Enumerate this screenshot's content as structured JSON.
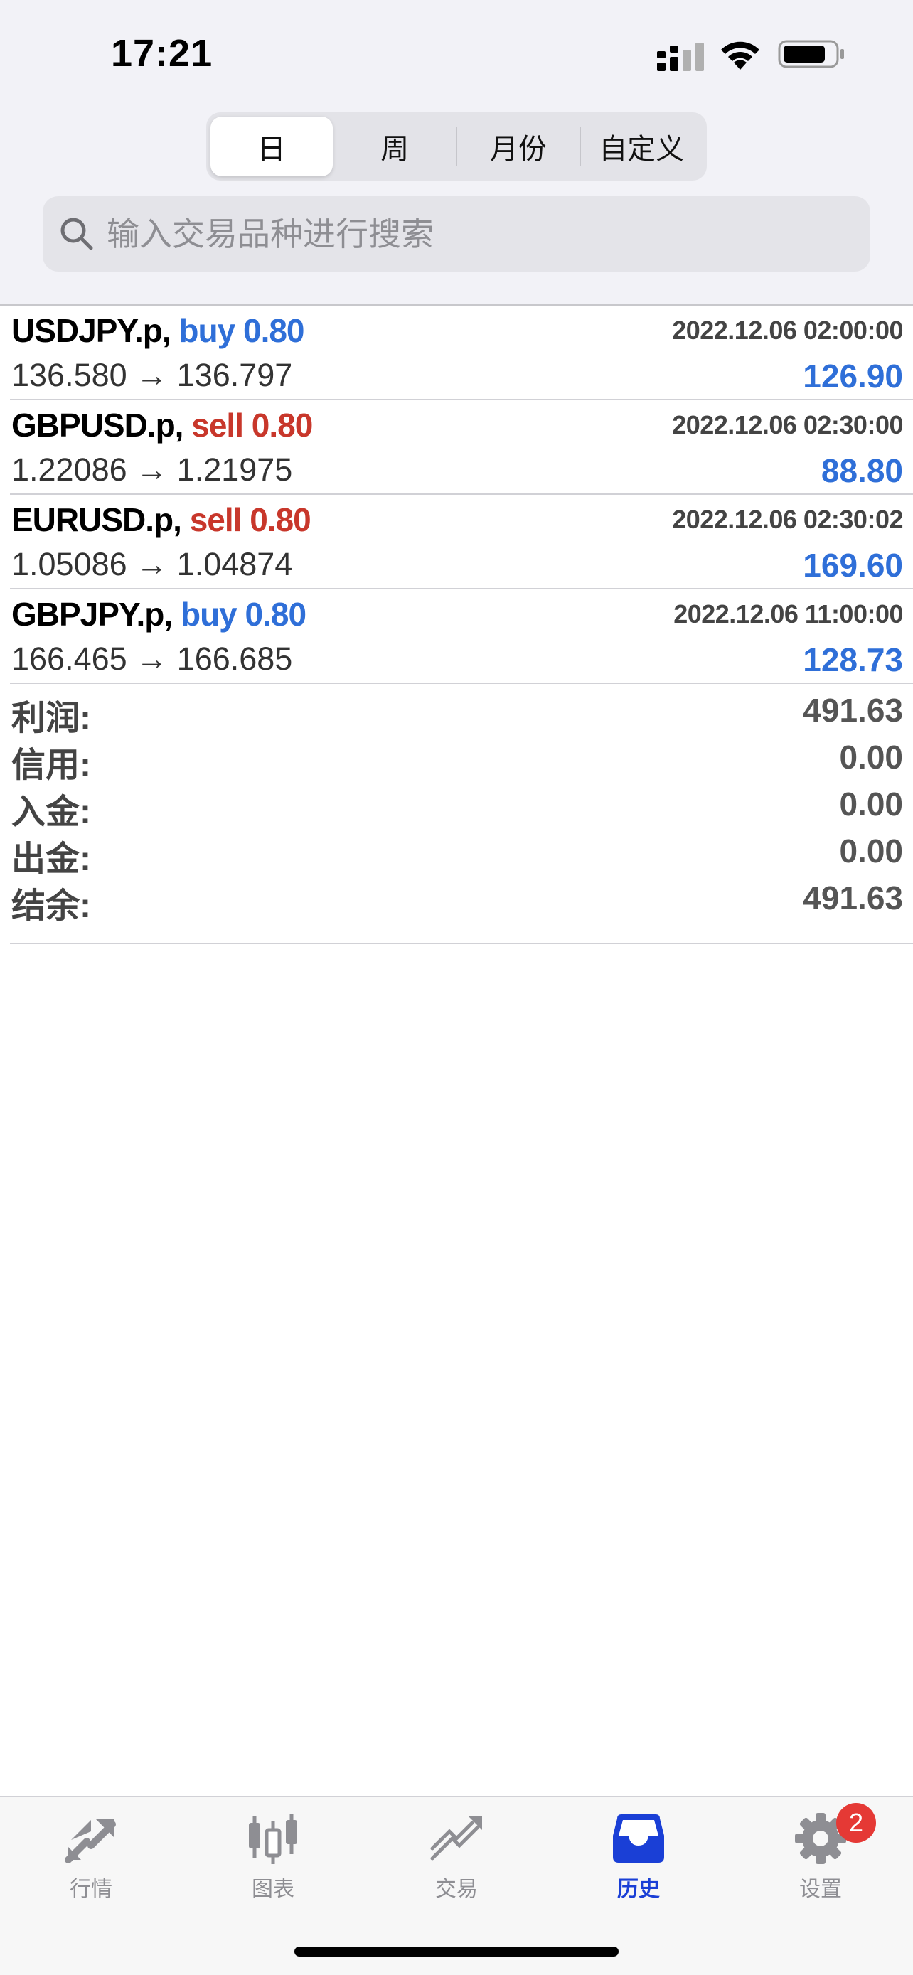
{
  "status_bar": {
    "time": "17:21"
  },
  "period_tabs": [
    {
      "label": "日",
      "active": true
    },
    {
      "label": "周",
      "active": false
    },
    {
      "label": "月份",
      "active": false
    },
    {
      "label": "自定义",
      "active": false
    }
  ],
  "search": {
    "placeholder": "输入交易品种进行搜索"
  },
  "trades": [
    {
      "symbol": "USDJPY.p,",
      "side": "buy",
      "volume": "0.80",
      "time": "2022.12.06 02:00:00",
      "prices": "136.580 → 136.797",
      "profit": "126.90"
    },
    {
      "symbol": "GBPUSD.p,",
      "side": "sell",
      "volume": "0.80",
      "time": "2022.12.06 02:30:00",
      "prices": "1.22086 → 1.21975",
      "profit": "88.80"
    },
    {
      "symbol": "EURUSD.p,",
      "side": "sell",
      "volume": "0.80",
      "time": "2022.12.06 02:30:02",
      "prices": "1.05086 → 1.04874",
      "profit": "169.60"
    },
    {
      "symbol": "GBPJPY.p,",
      "side": "buy",
      "volume": "0.80",
      "time": "2022.12.06 11:00:00",
      "prices": "166.465 → 166.685",
      "profit": "128.73"
    }
  ],
  "summary": [
    {
      "label": "利润:",
      "value": "491.63"
    },
    {
      "label": "信用:",
      "value": "0.00"
    },
    {
      "label": "入金:",
      "value": "0.00"
    },
    {
      "label": "出金:",
      "value": "0.00"
    },
    {
      "label": "结余:",
      "value": "491.63"
    }
  ],
  "tabbar": {
    "items": [
      {
        "label": "行情",
        "icon": "quotes-icon"
      },
      {
        "label": "图表",
        "icon": "chart-icon"
      },
      {
        "label": "交易",
        "icon": "trade-icon"
      },
      {
        "label": "历史",
        "icon": "history-icon",
        "active": true
      },
      {
        "label": "设置",
        "icon": "gear-icon",
        "badge": "2"
      }
    ]
  },
  "colors": {
    "buy": "#2f6fd8",
    "sell": "#c8372b",
    "active_tab": "#1a3fd6",
    "badge": "#e53935"
  }
}
